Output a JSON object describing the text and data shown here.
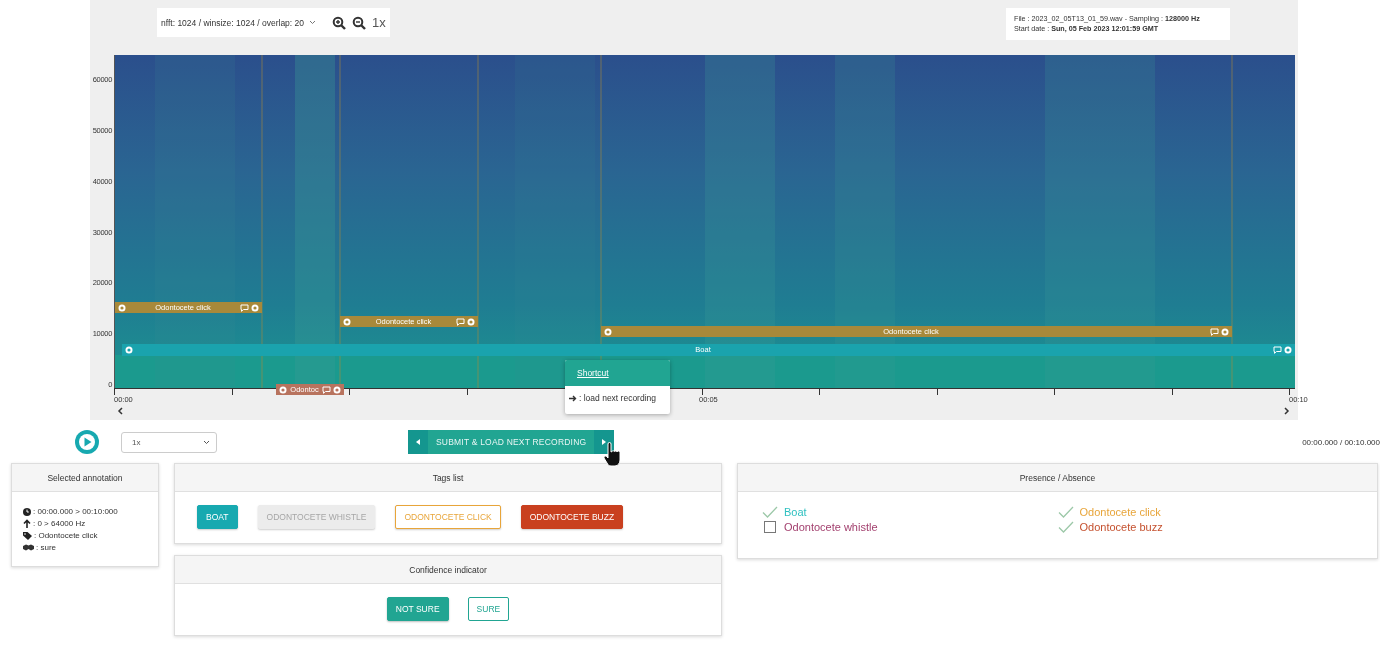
{
  "toolbar": {
    "fft_select": "nfft: 1024 / winsize: 1024 / overlap: 20",
    "zoom_level": "1x"
  },
  "file_info": [
    "File : 2023_02_05T13_01_59.wav - Sampling : **128000 Hz**",
    "Start date : **Sun, 05 Feb 2023 12:01:59 GMT**"
  ],
  "spectrogram": {
    "y_ticks": [
      "60000",
      "50000",
      "40000",
      "30000",
      "20000",
      "10000",
      "0"
    ],
    "x_ticks": [
      "00:00",
      "00:05",
      "00:10"
    ],
    "annotations": [
      {
        "label": "Odontocete click",
        "color": "#a8893a"
      },
      {
        "label": "Odontocete click",
        "color": "#a8893a"
      },
      {
        "label": "Odontocete click",
        "color": "#a8893a"
      },
      {
        "label": "Boat",
        "color": "#1aa3ad"
      },
      {
        "label": "Odontoc",
        "color": "#b8735e"
      }
    ]
  },
  "shortcut_tooltip": {
    "title": "Shortcut",
    "text": ": load next recording"
  },
  "player": {
    "speed": "1x",
    "time": "00:00.000 / 00:10.000"
  },
  "submit_button": "SUBMIT & LOAD NEXT RECORDING",
  "selected_annotation": {
    "title": "Selected annotation",
    "lines": [
      {
        "kind": "time",
        "text": ": 00:00.000 > 00:10:000"
      },
      {
        "kind": "frequency",
        "text": ": 0 > 64000 Hz"
      },
      {
        "kind": "tag",
        "text": ": Odontocete click"
      },
      {
        "kind": "confidence",
        "text": ":  sure"
      }
    ]
  },
  "tags_list": {
    "title": "Tags list",
    "tags": [
      {
        "label": "BOAT",
        "kind": "filled",
        "color": "#17a9b0"
      },
      {
        "label": "ODONTOCETE WHISTLE",
        "kind": "disabled"
      },
      {
        "label": "ODONTOCETE CLICK",
        "kind": "outline",
        "color": "#e8a53a"
      },
      {
        "label": "ODONTOCETE BUZZ",
        "kind": "filled",
        "color": "#c9401f"
      }
    ]
  },
  "confidence_indicator": {
    "title": "Confidence indicator",
    "options": [
      {
        "label": "NOT SURE",
        "selected": true
      },
      {
        "label": "SURE",
        "selected": false
      }
    ]
  },
  "presence_absence": {
    "title": "Presence / Absence",
    "items": [
      {
        "label": "Boat",
        "checked": true,
        "color": "#2fc0c0"
      },
      {
        "label": "Odontocete click",
        "checked": true,
        "color": "#e8a53a"
      },
      {
        "label": "Odontocete whistle",
        "checked": false,
        "color": "#a3416f"
      },
      {
        "label": "Odontocete buzz",
        "checked": true,
        "color": "#c5512f"
      }
    ]
  }
}
